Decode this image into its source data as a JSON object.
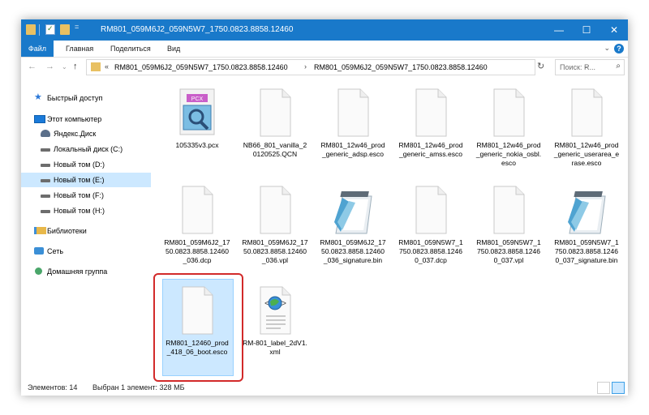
{
  "window": {
    "title": "RM801_059M6J2_059N5W7_1750.0823.8858.12460",
    "controls": {
      "minimize": "—",
      "maximize": "☐",
      "close": "✕"
    },
    "qa_arrow": "="
  },
  "ribbon": {
    "file_tab": "Файл",
    "tabs": [
      "Главная",
      "Поделиться",
      "Вид"
    ],
    "expand": "⌄",
    "help": "?"
  },
  "nav_buttons": {
    "back": "←",
    "forward": "→",
    "dropdown": "⌄",
    "up": "↑"
  },
  "address": {
    "overflow": "«",
    "segments": [
      "RM801_059M6J2_059N5W7_1750.0823.8858.12460",
      "RM801_059M6J2_059N5W7_1750.0823.8858.12460"
    ],
    "separator": "›",
    "dropdown": "⌄",
    "refresh": "↻"
  },
  "search": {
    "placeholder": "Поиск: R...",
    "icon": "⌕"
  },
  "nav_pane": {
    "items": [
      {
        "label": "Быстрый доступ",
        "icon": "star-icon"
      },
      {
        "label": "Этот компьютер",
        "icon": "computer-icon"
      },
      {
        "label": "Яндекс.Диск",
        "icon": "yandex-disk-icon"
      },
      {
        "label": "Локальный диск (C:)",
        "icon": "drive-icon"
      },
      {
        "label": "Новый том (D:)",
        "icon": "drive-icon"
      },
      {
        "label": "Новый том (E:)",
        "icon": "drive-icon",
        "selected": true
      },
      {
        "label": "Новый том (F:)",
        "icon": "drive-icon"
      },
      {
        "label": "Новый том (H:)",
        "icon": "drive-icon"
      },
      {
        "label": "Библиотеки",
        "icon": "libraries-icon"
      },
      {
        "label": "Сеть",
        "icon": "network-icon"
      },
      {
        "label": "Домашняя группа",
        "icon": "homegroup-icon"
      }
    ]
  },
  "files": [
    {
      "name": "105335v3.pcx",
      "icon": "pcx-image-icon",
      "badge": "PCX"
    },
    {
      "name": "NB66_801_vanilla_20120525.QCN",
      "icon": "blank-file-icon"
    },
    {
      "name": "RM801_12w46_prod_generic_adsp.esco",
      "icon": "blank-file-icon"
    },
    {
      "name": "RM801_12w46_prod_generic_amss.esco",
      "icon": "blank-file-icon"
    },
    {
      "name": "RM801_12w46_prod_generic_nokia_osbl.esco",
      "icon": "blank-file-icon"
    },
    {
      "name": "RM801_12w46_prod_generic_userarea_erase.esco",
      "icon": "blank-file-icon"
    },
    {
      "name": "RM801_059M6J2_1750.0823.8858.12460_036.dcp",
      "icon": "blank-file-icon"
    },
    {
      "name": "RM801_059M6J2_1750.0823.8858.12460_036.vpl",
      "icon": "blank-file-icon"
    },
    {
      "name": "RM801_059M6J2_1750.0823.8858.12460_036_signature.bin",
      "icon": "notepad-icon"
    },
    {
      "name": "RM801_059N5W7_1750.0823.8858.12460_037.dcp",
      "icon": "blank-file-icon"
    },
    {
      "name": "RM801_059N5W7_1750.0823.8858.12460_037.vpl",
      "icon": "blank-file-icon"
    },
    {
      "name": "RM801_059N5W7_1750.0823.8858.12460_037_signature.bin",
      "icon": "notepad-icon"
    },
    {
      "name": "RM801_12460_prod_418_06_boot.esco",
      "icon": "blank-file-icon",
      "selected": true
    },
    {
      "name": "RM-801_label_2dV1.xml",
      "icon": "xml-file-icon"
    }
  ],
  "status": {
    "items_count": "Элементов: 14",
    "selected": "Выбран 1 элемент: 328 МБ"
  },
  "colors": {
    "titlebar": "#1979ca",
    "selection": "#cce8ff",
    "highlight_border": "#d22a2a"
  }
}
